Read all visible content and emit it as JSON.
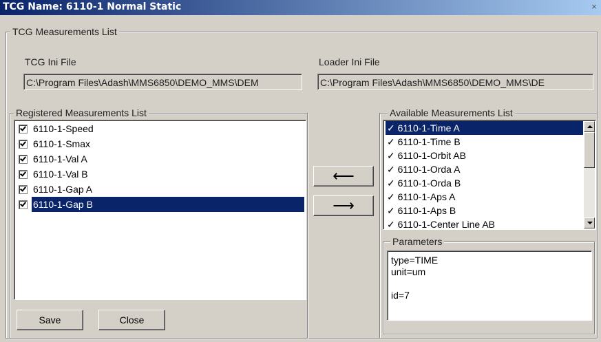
{
  "window": {
    "title": "TCG Name: 6110-1 Normal Static",
    "close_glyph": "×"
  },
  "main_group": {
    "legend": "TCG Measurements List"
  },
  "tcg_ini": {
    "label": "TCG Ini File",
    "value": "C:\\Program Files\\Adash\\MMS6850\\DEMO_MMS\\DEM"
  },
  "loader_ini": {
    "label": "Loader Ini File",
    "value": "C:\\Program Files\\Adash\\MMS6850\\DEMO_MMS\\DE"
  },
  "registered": {
    "legend": "Registered Measurements List",
    "items": [
      {
        "label": "6110-1-Speed",
        "checked": true
      },
      {
        "label": "6110-1-Smax",
        "checked": true
      },
      {
        "label": "6110-1-Val A",
        "checked": true
      },
      {
        "label": "6110-1-Val B",
        "checked": true
      },
      {
        "label": "6110-1-Gap A",
        "checked": true
      },
      {
        "label": "6110-1-Gap B",
        "checked": true,
        "selected": true
      }
    ]
  },
  "transfer": {
    "left_arrow": "⟵",
    "right_arrow": "⟶"
  },
  "available": {
    "legend": "Available Measurements List",
    "items": [
      {
        "label": "✓ 6110-1-Time A",
        "selected": true
      },
      {
        "label": "✓ 6110-1-Time B"
      },
      {
        "label": "✓ 6110-1-Orbit AB"
      },
      {
        "label": "✓ 6110-1-Orda A"
      },
      {
        "label": "✓ 6110-1-Orda B"
      },
      {
        "label": "✓ 6110-1-Aps A"
      },
      {
        "label": "✓ 6110-1-Aps B"
      },
      {
        "label": "✓ 6110-1-Center Line AB"
      }
    ]
  },
  "parameters": {
    "legend": "Parameters",
    "text": "type=TIME\nunit=um\n\nid=7"
  },
  "buttons": {
    "save": "Save",
    "close": "Close"
  }
}
